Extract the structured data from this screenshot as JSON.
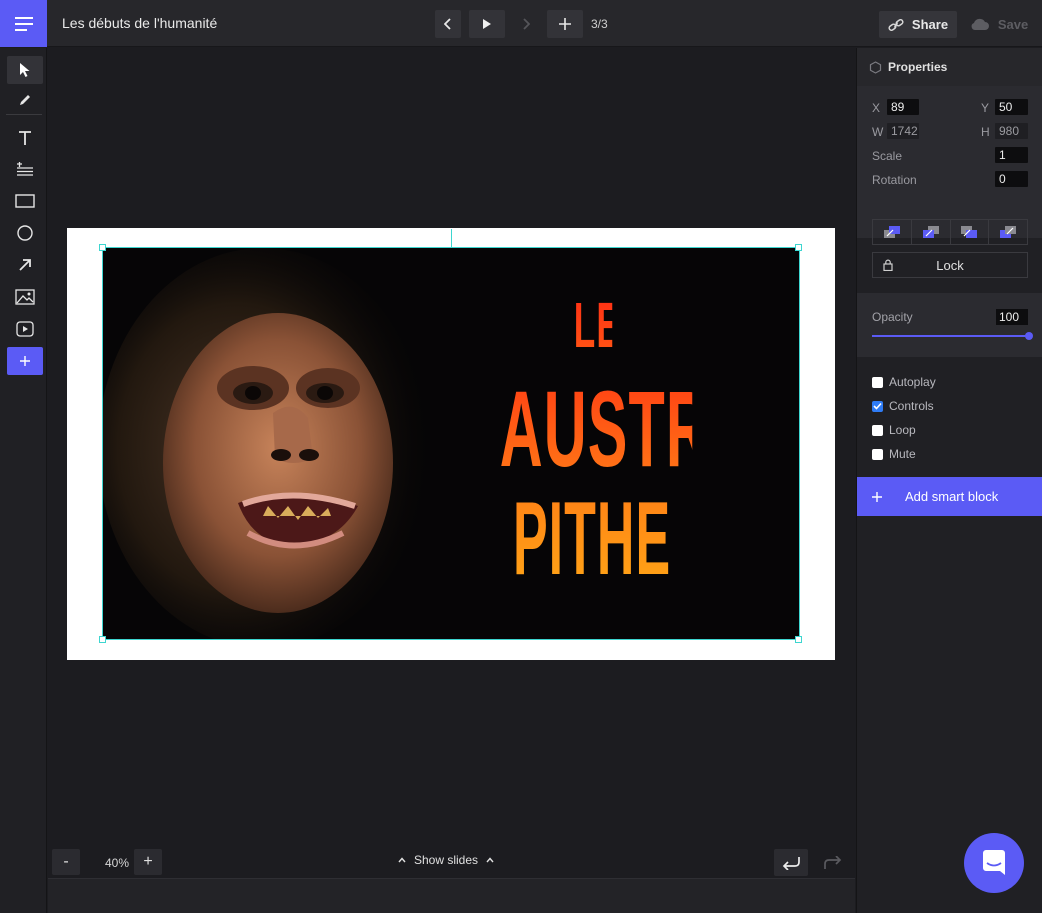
{
  "header": {
    "title": "Les débuts de l'humanité",
    "slide_counter": "3/3",
    "share_label": "Share",
    "save_label": "Save"
  },
  "slide": {
    "line1": "LES",
    "line2": "AUSTRALO",
    "line3": "PITHEQUES"
  },
  "properties": {
    "title": "Properties",
    "x_label": "X",
    "x_value": "89",
    "y_label": "Y",
    "y_value": "50",
    "w_label": "W",
    "w_value": "1742",
    "h_label": "H",
    "h_value": "980",
    "scale_label": "Scale",
    "scale_value": "1",
    "rotation_label": "Rotation",
    "rotation_value": "0",
    "lock_label": "Lock",
    "opacity_label": "Opacity",
    "opacity_value": "100",
    "opacity_level": 1.0,
    "checkboxes": [
      {
        "label": "Autoplay",
        "checked": false
      },
      {
        "label": "Controls",
        "checked": true
      },
      {
        "label": "Loop",
        "checked": false
      },
      {
        "label": "Mute",
        "checked": false
      }
    ],
    "smart_block_label": "Add smart block"
  },
  "footer": {
    "zoom_minus": "-",
    "zoom_value": "40%",
    "zoom_plus": "+",
    "show_slides_label": "Show slides"
  },
  "colors": {
    "accent": "#5b5bf5",
    "selection": "#3dd6d0",
    "title_gradient_top": "#ff3a14",
    "title_gradient_bottom": "#ffa216"
  }
}
